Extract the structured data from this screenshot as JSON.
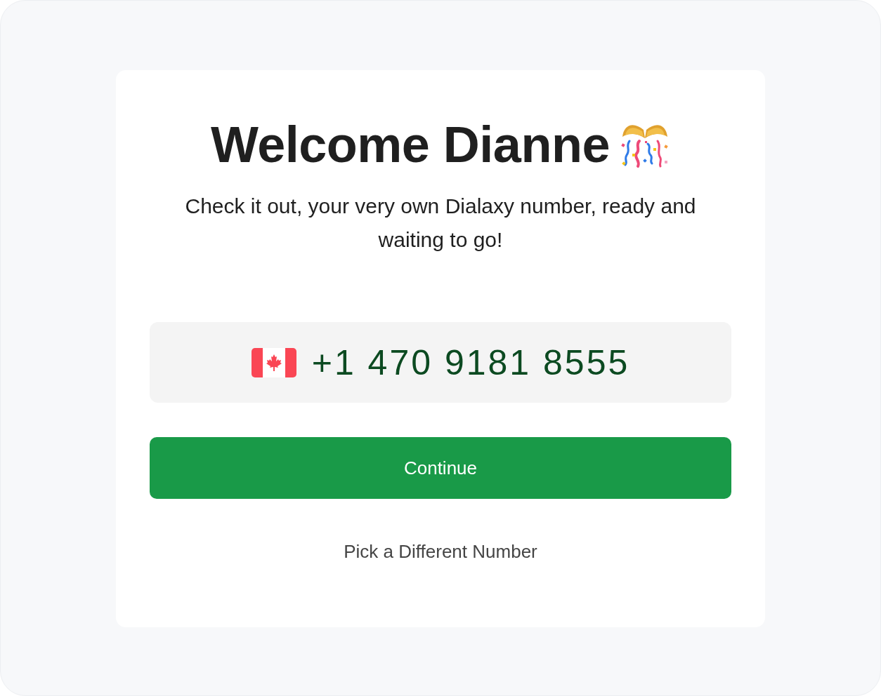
{
  "card": {
    "title": "Welcome Dianne",
    "subtitle": "Check it out, your very own Dialaxy number, ready and waiting to go!",
    "phone_number": "+1 470 9181 8555",
    "primary_button": "Continue",
    "secondary_link": "Pick a Different Number"
  }
}
